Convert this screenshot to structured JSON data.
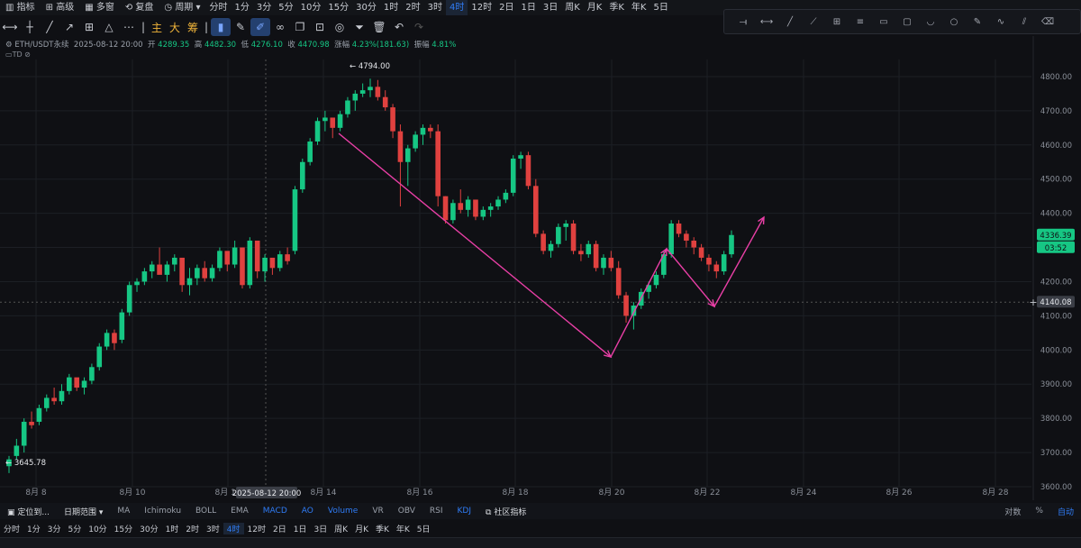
{
  "topbar": {
    "items": [
      {
        "label": "指标",
        "icon": "indicator-icon"
      },
      {
        "label": "高级",
        "icon": "chart-icon"
      },
      {
        "label": "多窗",
        "icon": "grid-icon"
      },
      {
        "label": "复盘",
        "icon": "replay-icon"
      },
      {
        "label": "周期",
        "icon": "clock-icon"
      }
    ],
    "intervals": [
      "分时",
      "1分",
      "3分",
      "5分",
      "10分",
      "15分",
      "30分",
      "1时",
      "2时",
      "3时",
      "4时",
      "12时",
      "2日",
      "1日",
      "3日",
      "周K",
      "月K",
      "季K",
      "年K",
      "5日"
    ],
    "active_interval": "4时"
  },
  "toolbar": {
    "cn_buttons": [
      "主",
      "大",
      "筹"
    ]
  },
  "info": {
    "symbol": "ETH/USDT永续",
    "date": "2025-08-12 20:00",
    "open_label": "开",
    "open": "4289.35",
    "high_label": "高",
    "high": "4482.30",
    "low_label": "低",
    "low": "4276.10",
    "close_label": "收",
    "close": "4470.98",
    "change_label": "涨幅",
    "change": "4.23%(181.63)",
    "amp_label": "振幅",
    "amp": "4.81%",
    "sub": "TD"
  },
  "chart_data": {
    "type": "candlestick",
    "ylim": [
      3600,
      4850
    ],
    "y_ticks": [
      3600,
      3700,
      3800,
      3900,
      4000,
      4100,
      4200,
      4300,
      4400,
      4500,
      4600,
      4700,
      4800
    ],
    "y_tick_labels": [
      "3600.00",
      "3700.00",
      "3800.00",
      "3900.00",
      "4000.00",
      "4100.00",
      "4200.00",
      "4300.00",
      "4400.00",
      "4500.00",
      "4600.00",
      "4700.00",
      "4800.00"
    ],
    "x_labels": [
      "8月 8",
      "8月 10",
      "8月 12",
      "8月 14",
      "8月 16",
      "8月 18",
      "8月 20",
      "8月 22",
      "8月 24",
      "8月 26",
      "8月 28"
    ],
    "crosshair_date": "2025-08-12 20:00",
    "crosshair_price": "4140.08",
    "last_price": "4336.39",
    "countdown": "03:52",
    "high_marker": "4794.00",
    "low_marker": "3645.78",
    "colors": {
      "up": "#16c784",
      "down": "#e0413f",
      "annotation": "#e93fa6"
    },
    "candles": [
      [
        3660,
        3690,
        3640,
        3680
      ],
      [
        3690,
        3740,
        3680,
        3720
      ],
      [
        3720,
        3800,
        3700,
        3790
      ],
      [
        3790,
        3820,
        3770,
        3780
      ],
      [
        3790,
        3840,
        3780,
        3830
      ],
      [
        3830,
        3870,
        3820,
        3860
      ],
      [
        3860,
        3890,
        3840,
        3850
      ],
      [
        3850,
        3900,
        3840,
        3880
      ],
      [
        3880,
        3930,
        3870,
        3920
      ],
      [
        3920,
        3910,
        3880,
        3890
      ],
      [
        3890,
        3920,
        3870,
        3910
      ],
      [
        3910,
        3960,
        3900,
        3950
      ],
      [
        3950,
        4020,
        3940,
        4010
      ],
      [
        4010,
        4060,
        4000,
        4050
      ],
      [
        4050,
        4060,
        4000,
        4020
      ],
      [
        4030,
        4120,
        4020,
        4110
      ],
      [
        4110,
        4200,
        4100,
        4190
      ],
      [
        4190,
        4210,
        4170,
        4200
      ],
      [
        4200,
        4240,
        4190,
        4230
      ],
      [
        4230,
        4260,
        4210,
        4250
      ],
      [
        4250,
        4300,
        4230,
        4220
      ],
      [
        4220,
        4260,
        4200,
        4250
      ],
      [
        4250,
        4280,
        4230,
        4270
      ],
      [
        4270,
        4250,
        4170,
        4190
      ],
      [
        4190,
        4240,
        4160,
        4210
      ],
      [
        4210,
        4250,
        4190,
        4240
      ],
      [
        4240,
        4260,
        4200,
        4210
      ],
      [
        4210,
        4250,
        4200,
        4240
      ],
      [
        4240,
        4300,
        4230,
        4290
      ],
      [
        4290,
        4280,
        4230,
        4250
      ],
      [
        4250,
        4320,
        4240,
        4300
      ],
      [
        4300,
        4290,
        4180,
        4190
      ],
      [
        4190,
        4330,
        4180,
        4320
      ],
      [
        4320,
        4300,
        4210,
        4230
      ],
      [
        4230,
        4280,
        4200,
        4270
      ],
      [
        4270,
        4260,
        4220,
        4240
      ],
      [
        4240,
        4290,
        4230,
        4280
      ],
      [
        4280,
        4300,
        4250,
        4260
      ],
      [
        4290,
        4480,
        4280,
        4470
      ],
      [
        4470,
        4560,
        4460,
        4550
      ],
      [
        4550,
        4620,
        4540,
        4610
      ],
      [
        4610,
        4680,
        4600,
        4670
      ],
      [
        4670,
        4700,
        4640,
        4680
      ],
      [
        4680,
        4670,
        4620,
        4650
      ],
      [
        4650,
        4700,
        4640,
        4690
      ],
      [
        4690,
        4740,
        4680,
        4730
      ],
      [
        4730,
        4760,
        4700,
        4750
      ],
      [
        4750,
        4780,
        4740,
        4760
      ],
      [
        4760,
        4794,
        4740,
        4770
      ],
      [
        4770,
        4790,
        4730,
        4740
      ],
      [
        4740,
        4760,
        4700,
        4710
      ],
      [
        4710,
        4720,
        4620,
        4640
      ],
      [
        4640,
        4660,
        4420,
        4550
      ],
      [
        4550,
        4600,
        4480,
        4590
      ],
      [
        4590,
        4640,
        4580,
        4630
      ],
      [
        4630,
        4660,
        4600,
        4650
      ],
      [
        4650,
        4660,
        4620,
        4640
      ],
      [
        4640,
        4660,
        4420,
        4450
      ],
      [
        4450,
        4450,
        4370,
        4380
      ],
      [
        4380,
        4440,
        4370,
        4430
      ],
      [
        4430,
        4470,
        4400,
        4410
      ],
      [
        4410,
        4450,
        4390,
        4440
      ],
      [
        4440,
        4440,
        4380,
        4390
      ],
      [
        4390,
        4420,
        4380,
        4410
      ],
      [
        4410,
        4430,
        4390,
        4420
      ],
      [
        4420,
        4450,
        4410,
        4440
      ],
      [
        4440,
        4470,
        4430,
        4460
      ],
      [
        4460,
        4570,
        4450,
        4560
      ],
      [
        4560,
        4580,
        4530,
        4570
      ],
      [
        4570,
        4580,
        4470,
        4480
      ],
      [
        4480,
        4500,
        4330,
        4340
      ],
      [
        4340,
        4350,
        4280,
        4290
      ],
      [
        4290,
        4320,
        4270,
        4310
      ],
      [
        4310,
        4370,
        4300,
        4360
      ],
      [
        4360,
        4380,
        4320,
        4370
      ],
      [
        4370,
        4380,
        4280,
        4290
      ],
      [
        4290,
        4310,
        4260,
        4280
      ],
      [
        4280,
        4320,
        4270,
        4310
      ],
      [
        4310,
        4320,
        4230,
        4240
      ],
      [
        4240,
        4280,
        4220,
        4270
      ],
      [
        4270,
        4290,
        4230,
        4240
      ],
      [
        4240,
        4260,
        4150,
        4160
      ],
      [
        4160,
        4170,
        4080,
        4100
      ],
      [
        4100,
        4140,
        4060,
        4130
      ],
      [
        4130,
        4180,
        4120,
        4170
      ],
      [
        4170,
        4200,
        4150,
        4190
      ],
      [
        4190,
        4230,
        4180,
        4220
      ],
      [
        4220,
        4290,
        4210,
        4280
      ],
      [
        4280,
        4380,
        4270,
        4370
      ],
      [
        4370,
        4380,
        4330,
        4340
      ],
      [
        4340,
        4350,
        4300,
        4320
      ],
      [
        4320,
        4330,
        4280,
        4300
      ],
      [
        4300,
        4310,
        4260,
        4270
      ],
      [
        4270,
        4280,
        4230,
        4250
      ],
      [
        4250,
        4260,
        4210,
        4230
      ],
      [
        4230,
        4290,
        4220,
        4280
      ],
      [
        4280,
        4350,
        4270,
        4336.39
      ]
    ],
    "annotation_points": [
      [
        376,
        108
      ],
      [
        678,
        356
      ],
      [
        740,
        236
      ],
      [
        793,
        300
      ],
      [
        848,
        201
      ]
    ]
  },
  "bottombar": {
    "locate": "定位到...",
    "date_range": "日期范围",
    "indicators": [
      "MA",
      "Ichimoku",
      "BOLL",
      "EMA",
      "MACD",
      "AO",
      "Volume",
      "VR",
      "OBV",
      "RSI",
      "KDJ"
    ],
    "active_indicators": [
      "MACD",
      "AO",
      "Volume",
      "KDJ"
    ],
    "community": "社区指标",
    "log": "对数",
    "percent": "%",
    "auto": "自动"
  },
  "drawbar": {
    "tools": [
      "horizontal-ray-icon",
      "segment-icon",
      "line-icon",
      "trend-line-icon",
      "add-icon",
      "parallel-icon",
      "rectangle-icon",
      "rounded-rect-icon",
      "arc-icon",
      "circle-icon",
      "pen-icon",
      "wave-icon",
      "brush-icon",
      "eraser-icon"
    ]
  }
}
